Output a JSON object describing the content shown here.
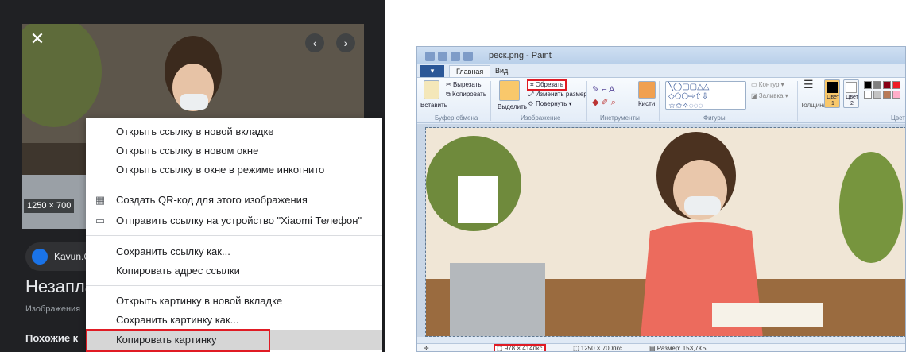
{
  "google": {
    "close_icon": "close-icon",
    "prev_icon": "chevron-left-icon",
    "next_icon": "chevron-right-icon",
    "dimensions": "1250 × 700",
    "source_name": "Kavun.C",
    "title": "Незапла",
    "subtitle": "Изображения",
    "similar": "Похожие к"
  },
  "context_menu": {
    "items": [
      {
        "label": "Открыть ссылку в новой вкладке"
      },
      {
        "label": "Открыть ссылку в новом окне"
      },
      {
        "label": "Открыть ссылку в окне в режиме инкогнито"
      },
      {
        "label": "Создать QR-код для этого изображения",
        "icon": "qr-code-icon"
      },
      {
        "label": "Отправить ссылку на устройство \"Xiaomi Телефон\"",
        "icon": "send-to-device-icon"
      },
      {
        "label": "Сохранить ссылку как..."
      },
      {
        "label": "Копировать адрес ссылки"
      },
      {
        "label": "Открыть картинку в новой вкладке"
      },
      {
        "label": "Сохранить картинку как..."
      },
      {
        "label": "Копировать картинку"
      }
    ],
    "highlighted_index": 9,
    "highlight_border_color": "#e01b24"
  },
  "paint": {
    "window_title": "pеск.png - Paint",
    "tab_file": "▾",
    "tabs": [
      "Главная",
      "Вид"
    ],
    "active_tab": 0,
    "clipboard": {
      "paste": "Вставить",
      "cut": "Вырезать",
      "copy": "Копировать",
      "group": "Буфер обмена"
    },
    "image": {
      "select": "Выделить",
      "crop": "Обрезать",
      "resize": "Изменить размер",
      "rotate": "Повернуть",
      "group": "Изображение"
    },
    "tools": {
      "group": "Инструменты",
      "brushes": "Кисти"
    },
    "shapes": {
      "outline": "Контур",
      "fill": "Заливка",
      "group": "Фигуры"
    },
    "size": "Толщина",
    "color1": "Цвет 1",
    "color2": "Цвет 2",
    "colors_group": "Цвета",
    "palette": [
      "#000000",
      "#7f7f7f",
      "#880015",
      "#ed1c24",
      "#ff7f27",
      "#ffffff",
      "#c3c3c3",
      "#b97a57",
      "#ffaec9",
      "#ffc90e"
    ],
    "status": {
      "selection": "978 × 414пкс",
      "image_size": "1250 × 700пкс",
      "file_size": "Размер: 153,7КБ"
    },
    "crop_highlight_color": "#e01b24"
  }
}
